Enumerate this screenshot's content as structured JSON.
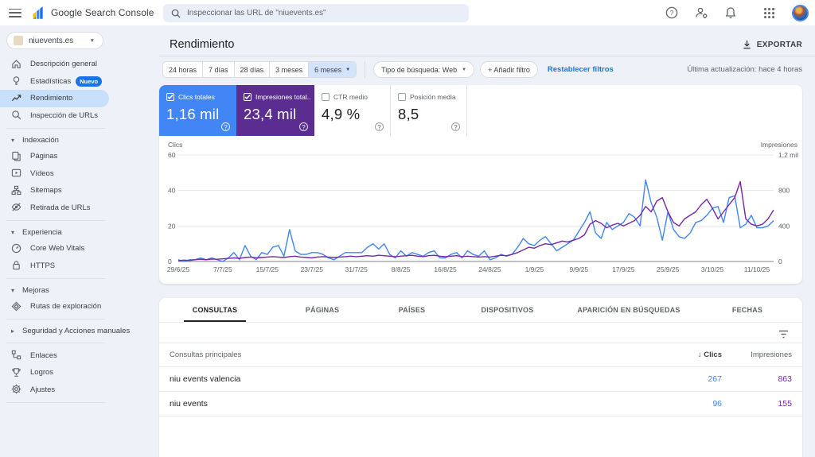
{
  "app": {
    "title": "Google Search Console",
    "search_placeholder": "Inspeccionar las URL de \"niuevents.es\"",
    "icons": [
      "menu-icon",
      "help-icon",
      "manage-accounts-icon",
      "notifications-icon",
      "apps-grid-icon",
      "avatar"
    ]
  },
  "sidebar": {
    "property": {
      "label": "niuevents.es"
    },
    "groups": [
      {
        "items": [
          {
            "icon": "home-icon",
            "label": "Descripción general"
          },
          {
            "icon": "bulb-icon",
            "label": "Estadísticas",
            "badge": "Nuevo"
          },
          {
            "icon": "performance-icon",
            "label": "Rendimiento",
            "selected": true
          },
          {
            "icon": "inspect-icon",
            "label": "Inspección de URLs"
          }
        ]
      },
      {
        "section": {
          "label": "Indexación",
          "collapsed": false
        },
        "items": [
          {
            "icon": "pages-icon",
            "label": "Páginas"
          },
          {
            "icon": "video-icon",
            "label": "Vídeos"
          },
          {
            "icon": "sitemap-icon",
            "label": "Sitemaps"
          },
          {
            "icon": "eye-off-icon",
            "label": "Retirada de URLs"
          }
        ]
      },
      {
        "section": {
          "label": "Experiencia",
          "collapsed": false
        },
        "items": [
          {
            "icon": "gauge-icon",
            "label": "Core Web Vitals"
          },
          {
            "icon": "lock-icon",
            "label": "HTTPS"
          }
        ]
      },
      {
        "section": {
          "label": "Mejoras",
          "collapsed": false
        },
        "items": [
          {
            "icon": "route-icon",
            "label": "Rutas de exploración"
          }
        ]
      },
      {
        "section": {
          "label": "Seguridad y Acciones manuales",
          "collapsed": true
        },
        "items": []
      },
      {
        "items": [
          {
            "icon": "links-icon",
            "label": "Enlaces"
          },
          {
            "icon": "trophy-icon",
            "label": "Logros"
          },
          {
            "icon": "gear-icon",
            "label": "Ajustes"
          }
        ]
      }
    ]
  },
  "header": {
    "page_title": "Rendimiento",
    "export_label": "EXPORTAR",
    "last_update": "Última actualización: hace 4 horas"
  },
  "filters": {
    "ranges": [
      "24 horas",
      "7 días",
      "28 días",
      "3 meses",
      "6 meses"
    ],
    "active_range": "6 meses",
    "search_type": "Tipo de búsqueda: Web",
    "add_filter": "+ Añadir filtro",
    "reset": "Restablecer filtros"
  },
  "metric_cards": [
    {
      "label": "Clics totales",
      "value": "1,16 mil",
      "checked": true,
      "color": "#4285f4",
      "style": "dark"
    },
    {
      "label": "Impresiones total..",
      "value": "23,4 mil",
      "checked": true,
      "color": "#5b2d90",
      "style": "dark"
    },
    {
      "label": "CTR medio",
      "value": "4,9 %",
      "checked": false,
      "color": "#ffffff",
      "style": "light"
    },
    {
      "label": "Posición media",
      "value": "8,5",
      "checked": false,
      "color": "#ffffff",
      "style": "light"
    }
  ],
  "chart_data": {
    "type": "line",
    "title": "",
    "xlabel": "",
    "left_axis": {
      "label": "Clics",
      "ticks": [
        0,
        20,
        40,
        60
      ],
      "max": 60
    },
    "right_axis": {
      "label": "Impresiones",
      "ticks": [
        "0",
        "400",
        "800",
        "1,2 mil"
      ],
      "max": 1200
    },
    "x_tick_labels": [
      "29/6/25",
      "7/7/25",
      "15/7/25",
      "23/7/25",
      "31/7/25",
      "8/8/25",
      "16/8/25",
      "24/8/25",
      "1/9/25",
      "9/9/25",
      "17/9/25",
      "25/9/25",
      "3/10/25",
      "11/10/25"
    ],
    "x_tick_day_index": [
      0,
      8,
      16,
      24,
      32,
      40,
      48,
      56,
      64,
      72,
      80,
      88,
      96,
      104
    ],
    "grid": true,
    "series": [
      {
        "name": "Clics",
        "color": "#4285f4",
        "axis": "left",
        "values": [
          1,
          0,
          1,
          1,
          2,
          1,
          2,
          1,
          0,
          2,
          5,
          1,
          9,
          3,
          1,
          5,
          4,
          8,
          9,
          3,
          18,
          6,
          4,
          4,
          5,
          5,
          4,
          2,
          1,
          3,
          5,
          5,
          5,
          5,
          8,
          10,
          7,
          10,
          4,
          2,
          6,
          3,
          5,
          4,
          3,
          5,
          6,
          2,
          2,
          4,
          5,
          2,
          6,
          4,
          3,
          6,
          1,
          2,
          4,
          3,
          4,
          8,
          13,
          10,
          9,
          12,
          14,
          10,
          6,
          8,
          10,
          12,
          17,
          22,
          28,
          16,
          13,
          22,
          18,
          20,
          22,
          27,
          25,
          20,
          46,
          33,
          25,
          12,
          28,
          18,
          14,
          13,
          16,
          22,
          23,
          26,
          30,
          31,
          22,
          36,
          37,
          19,
          21,
          26,
          19,
          19,
          20,
          23
        ]
      },
      {
        "name": "Impresiones",
        "color": "#7627a5",
        "axis": "right",
        "values": [
          10,
          15,
          12,
          20,
          25,
          20,
          28,
          25,
          30,
          35,
          40,
          35,
          45,
          50,
          40,
          45,
          50,
          55,
          50,
          45,
          55,
          60,
          50,
          45,
          40,
          50,
          55,
          50,
          45,
          50,
          55,
          60,
          55,
          60,
          65,
          60,
          70,
          65,
          60,
          55,
          60,
          65,
          70,
          60,
          55,
          65,
          70,
          60,
          55,
          60,
          65,
          55,
          60,
          55,
          50,
          55,
          50,
          60,
          70,
          65,
          80,
          100,
          130,
          160,
          150,
          180,
          200,
          190,
          210,
          230,
          220,
          240,
          260,
          300,
          420,
          460,
          430,
          380,
          410,
          430,
          400,
          430,
          460,
          520,
          620,
          560,
          680,
          720,
          560,
          440,
          400,
          480,
          520,
          560,
          640,
          700,
          600,
          480,
          560,
          640,
          720,
          900,
          480,
          420,
          400,
          420,
          480,
          580
        ]
      }
    ]
  },
  "table": {
    "tabs": [
      "CONSULTAS",
      "PÁGINAS",
      "PAÍSES",
      "DISPOSITIVOS",
      "APARICIÓN EN BÚSQUEDAS",
      "FECHAS"
    ],
    "active_tab": "CONSULTAS",
    "row_header": "Consultas principales",
    "col_clicks": "Clics",
    "col_impressions": "Impresiones",
    "clicks_color": "#4285f4",
    "impressions_color": "#7627a5",
    "rows": [
      {
        "query": "niu events valencia",
        "clicks": "267",
        "impressions": "863"
      },
      {
        "query": "niu events",
        "clicks": "96",
        "impressions": "155"
      }
    ]
  }
}
